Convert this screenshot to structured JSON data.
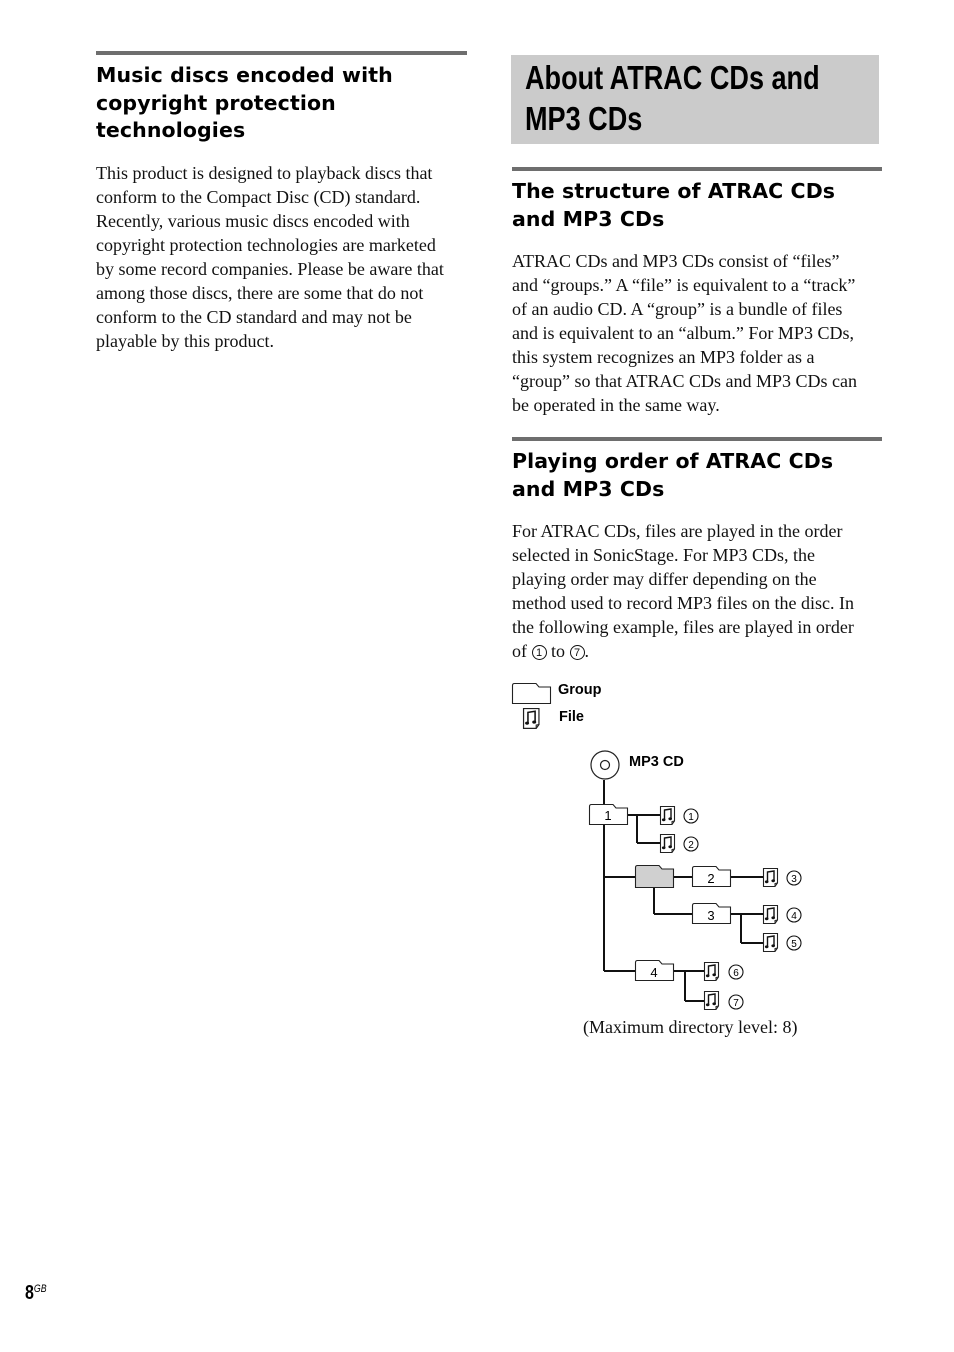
{
  "left_column": {
    "heading": "Music discs encoded with copyright protection technologies",
    "heading_lines": [
      "Music discs encoded with",
      "copyright protection",
      "technologies"
    ],
    "paragraph_lines": [
      "This product is designed to playback discs that",
      "conform to the Compact Disc (CD) standard.",
      "Recently, various music discs encoded with",
      "copyright protection technologies are marketed",
      "by some record companies. Please be aware that",
      "among those discs, there are some that do not",
      "conform to the CD standard and may not be",
      "playable by this product."
    ]
  },
  "right_column": {
    "banner_title_lines": [
      "About ATRAC CDs and",
      "MP3 CDs"
    ],
    "section_structure": {
      "heading_lines": [
        "The structure of ATRAC CDs",
        "and MP3 CDs"
      ],
      "paragraph_lines": [
        "ATRAC CDs and MP3 CDs consist of “files”",
        "and “groups.” A “file” is equivalent to a “track”",
        "of an audio CD. A “group” is a bundle of files",
        "and is equivalent to an “album.” For MP3 CDs,",
        "this system recognizes an MP3 folder as a",
        "“group” so that ATRAC CDs and MP3 CDs can",
        "be operated in the same way."
      ]
    },
    "section_playing_order": {
      "heading_lines": [
        "Playing order of ATRAC CDs",
        "and MP3 CDs"
      ],
      "paragraph_lines": [
        "For ATRAC CDs, files are played in the order",
        "selected in SonicStage. For MP3 CDs, the",
        "playing order may differ depending on the",
        "method used to record MP3 files on the disc. In",
        "the following example, files are played in order"
      ],
      "last_line": {
        "prefix": "of ",
        "start": "1",
        "middle": " to ",
        "end": "7",
        "suffix": "."
      }
    }
  },
  "diagram": {
    "legend": [
      {
        "icon": "folder-icon",
        "label": "Group"
      },
      {
        "icon": "music-file-icon",
        "label": "File"
      }
    ],
    "root": {
      "icon": "disc-icon",
      "label": "MP3 CD"
    },
    "groups": [
      {
        "label": "1",
        "files": [
          "1",
          "2"
        ]
      },
      {
        "label": "",
        "shaded": true,
        "files": []
      },
      {
        "label": "2",
        "files": [
          "3"
        ]
      },
      {
        "label": "3",
        "files": [
          "4",
          "5"
        ]
      },
      {
        "label": "4",
        "files": [
          "6",
          "7"
        ]
      }
    ],
    "caption": "(Maximum directory level: 8)"
  },
  "footer": {
    "page_number": "8",
    "page_suffix": "GB"
  }
}
